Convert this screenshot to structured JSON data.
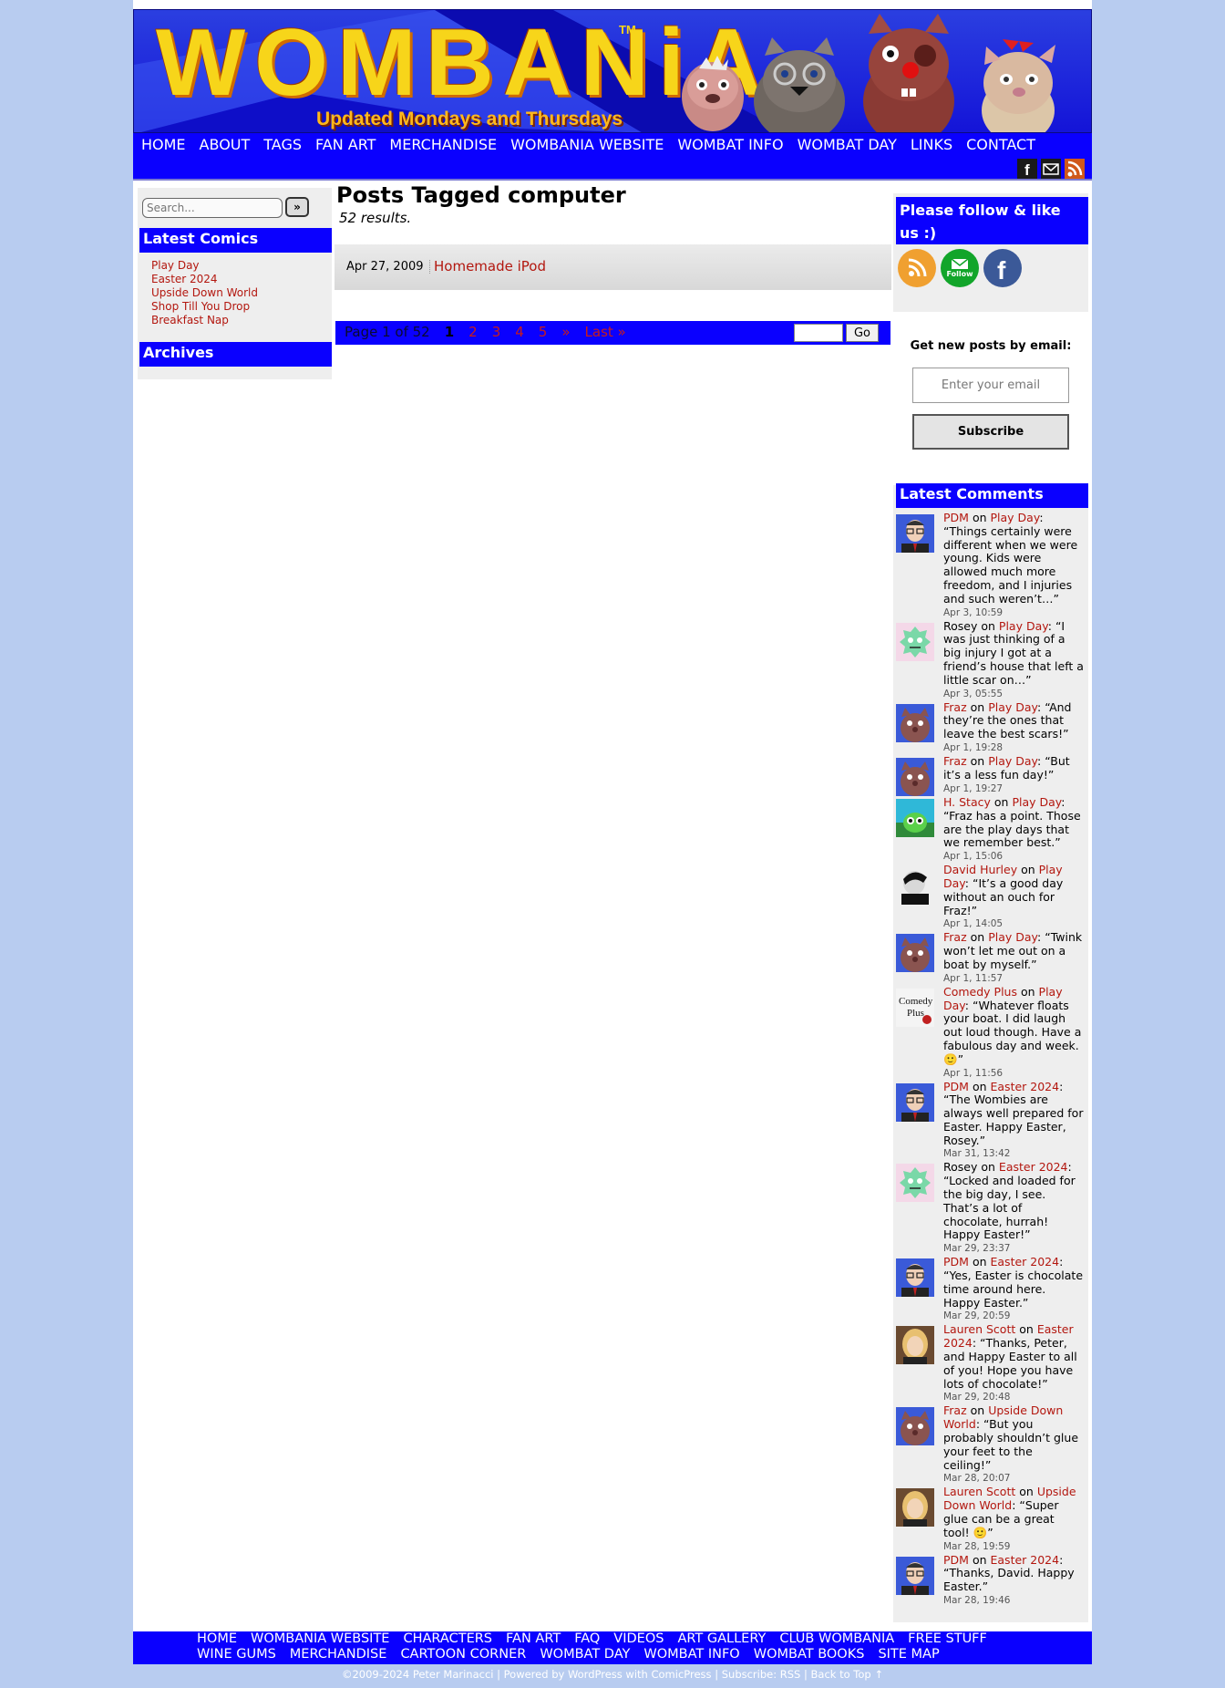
{
  "header": {
    "logo": "WOMBANiA",
    "trademark": "TM",
    "tagline": "Updated Mondays and Thursdays"
  },
  "nav": {
    "items": [
      "HOME",
      "ABOUT",
      "TAGS",
      "FAN ART",
      "MERCHANDISE",
      "WOMBANIA WEBSITE",
      "WOMBAT INFO",
      "WOMBAT DAY",
      "LINKS",
      "CONTACT"
    ],
    "icons": [
      "facebook-icon",
      "email-icon",
      "rss-icon"
    ]
  },
  "search": {
    "placeholder": "Search...",
    "button": "»"
  },
  "left_sidebar": {
    "latest_comics_title": "Latest Comics",
    "latest_comics": [
      "Play Day",
      "Easter 2024",
      "Upside Down World",
      "Shop Till You Drop",
      "Breakfast Nap"
    ],
    "archives_title": "Archives"
  },
  "main": {
    "title": "Posts Tagged computer",
    "results": "52 results.",
    "post": {
      "date": "Apr 27, 2009",
      "title": "Homemade iPod"
    },
    "pager": {
      "page_of": "Page 1 of 52",
      "current": "1",
      "pages": [
        "2",
        "3",
        "4",
        "5"
      ],
      "next": "»",
      "last": "Last »",
      "go": "Go"
    }
  },
  "right_sidebar": {
    "follow_title": "Please follow & like us :)",
    "follow_icons": [
      "rss-icon",
      "email-follow-icon",
      "facebook-icon"
    ],
    "follow_label": "Follow",
    "email_heading": "Get new posts by email:",
    "email_placeholder": "Enter your email",
    "subscribe": "Subscribe",
    "latest_comments_title": "Latest Comments",
    "on": "on",
    "comments": [
      {
        "author": "PDM",
        "author_linked": true,
        "post": "Play Day",
        "text": "“Things certainly were different when we were young. Kids were allowed much more freedom, and I injuries and such weren’t…”",
        "time": "Apr 3, 10:59",
        "avatar": "pdm"
      },
      {
        "author": "Rosey",
        "author_linked": false,
        "post": "Play Day",
        "text": "“I was just thinking of a big injury I got at a friend’s house that left a little scar on…”",
        "time": "Apr 3, 05:55",
        "avatar": "rosey"
      },
      {
        "author": "Fraz",
        "author_linked": true,
        "post": "Play Day",
        "text": "“And they’re the ones that leave the best scars!”",
        "time": "Apr 1, 19:28",
        "avatar": "fraz"
      },
      {
        "author": "Fraz",
        "author_linked": true,
        "post": "Play Day",
        "text": "“But it’s a less fun day!”",
        "time": "Apr 1, 19:27",
        "avatar": "fraz"
      },
      {
        "author": "H. Stacy",
        "author_linked": true,
        "post": "Play Day",
        "text": "“Fraz has a point. Those are the play days that we remember best.”",
        "time": "Apr 1, 15:06",
        "avatar": "hstacy"
      },
      {
        "author": "David Hurley",
        "author_linked": true,
        "post": "Play Day",
        "text": "“It’s a good day without an ouch for Fraz!”",
        "time": "Apr 1, 14:05",
        "avatar": "david"
      },
      {
        "author": "Fraz",
        "author_linked": true,
        "post": "Play Day",
        "text": "“Twink won’t let me out on a boat by myself.”",
        "time": "Apr 1, 11:57",
        "avatar": "fraz"
      },
      {
        "author": "Comedy Plus",
        "author_linked": true,
        "post": "Play Day",
        "text": "“Whatever floats your boat. I did laugh out loud though. Have a fabulous day and week. 🙂”",
        "time": "Apr 1, 11:56",
        "avatar": "comedy"
      },
      {
        "author": "PDM",
        "author_linked": true,
        "post": "Easter 2024",
        "text": "“The Wombies are always well prepared for Easter. Happy Easter, Rosey.”",
        "time": "Mar 31, 13:42",
        "avatar": "pdm"
      },
      {
        "author": "Rosey",
        "author_linked": false,
        "post": "Easter 2024",
        "text": "“Locked and loaded for the big day, I see. That’s a lot of chocolate, hurrah! Happy Easter!”",
        "time": "Mar 29, 23:37",
        "avatar": "rosey"
      },
      {
        "author": "PDM",
        "author_linked": true,
        "post": "Easter 2024",
        "text": "“Yes, Easter is chocolate time around here. Happy Easter.”",
        "time": "Mar 29, 20:59",
        "avatar": "pdm"
      },
      {
        "author": "Lauren Scott",
        "author_linked": true,
        "post": "Easter 2024",
        "text": "“Thanks, Peter, and Happy Easter to all of you! Hope you have lots of chocolate!”",
        "time": "Mar 29, 20:48",
        "avatar": "lauren"
      },
      {
        "author": "Fraz",
        "author_linked": true,
        "post": "Upside Down World",
        "text": "“But you probably shouldn’t glue your feet to the ceiling!”",
        "time": "Mar 28, 20:07",
        "avatar": "fraz"
      },
      {
        "author": "Lauren Scott",
        "author_linked": true,
        "post": "Upside Down World",
        "text": "“Super glue can be a great tool! 🙂”",
        "time": "Mar 28, 19:59",
        "avatar": "lauren"
      },
      {
        "author": "PDM",
        "author_linked": true,
        "post": "Easter 2024",
        "text": "“Thanks, David. Happy Easter.”",
        "time": "Mar 28, 19:46",
        "avatar": "pdm"
      }
    ]
  },
  "footer": {
    "items": [
      "HOME",
      "WOMBANIA WEBSITE",
      "CHARACTERS",
      "FAN ART",
      "FAQ",
      "VIDEOS",
      "ART GALLERY",
      "CLUB WOMBANIA",
      "FREE STUFF",
      "WINE GUMS",
      "MERCHANDISE",
      "CARTOON CORNER",
      "WOMBAT DAY",
      "WOMBAT INFO",
      "WOMBAT BOOKS",
      "SITE MAP"
    ],
    "copyright": "©2009-2024 Peter Marinacci | Powered by WordPress with ComicPress | Subscribe: RSS | Back to Top ↑"
  },
  "colors": {
    "nav_blue": "#0a00ff",
    "link_red": "#b3170f",
    "page_bg": "#b8ccf0"
  }
}
